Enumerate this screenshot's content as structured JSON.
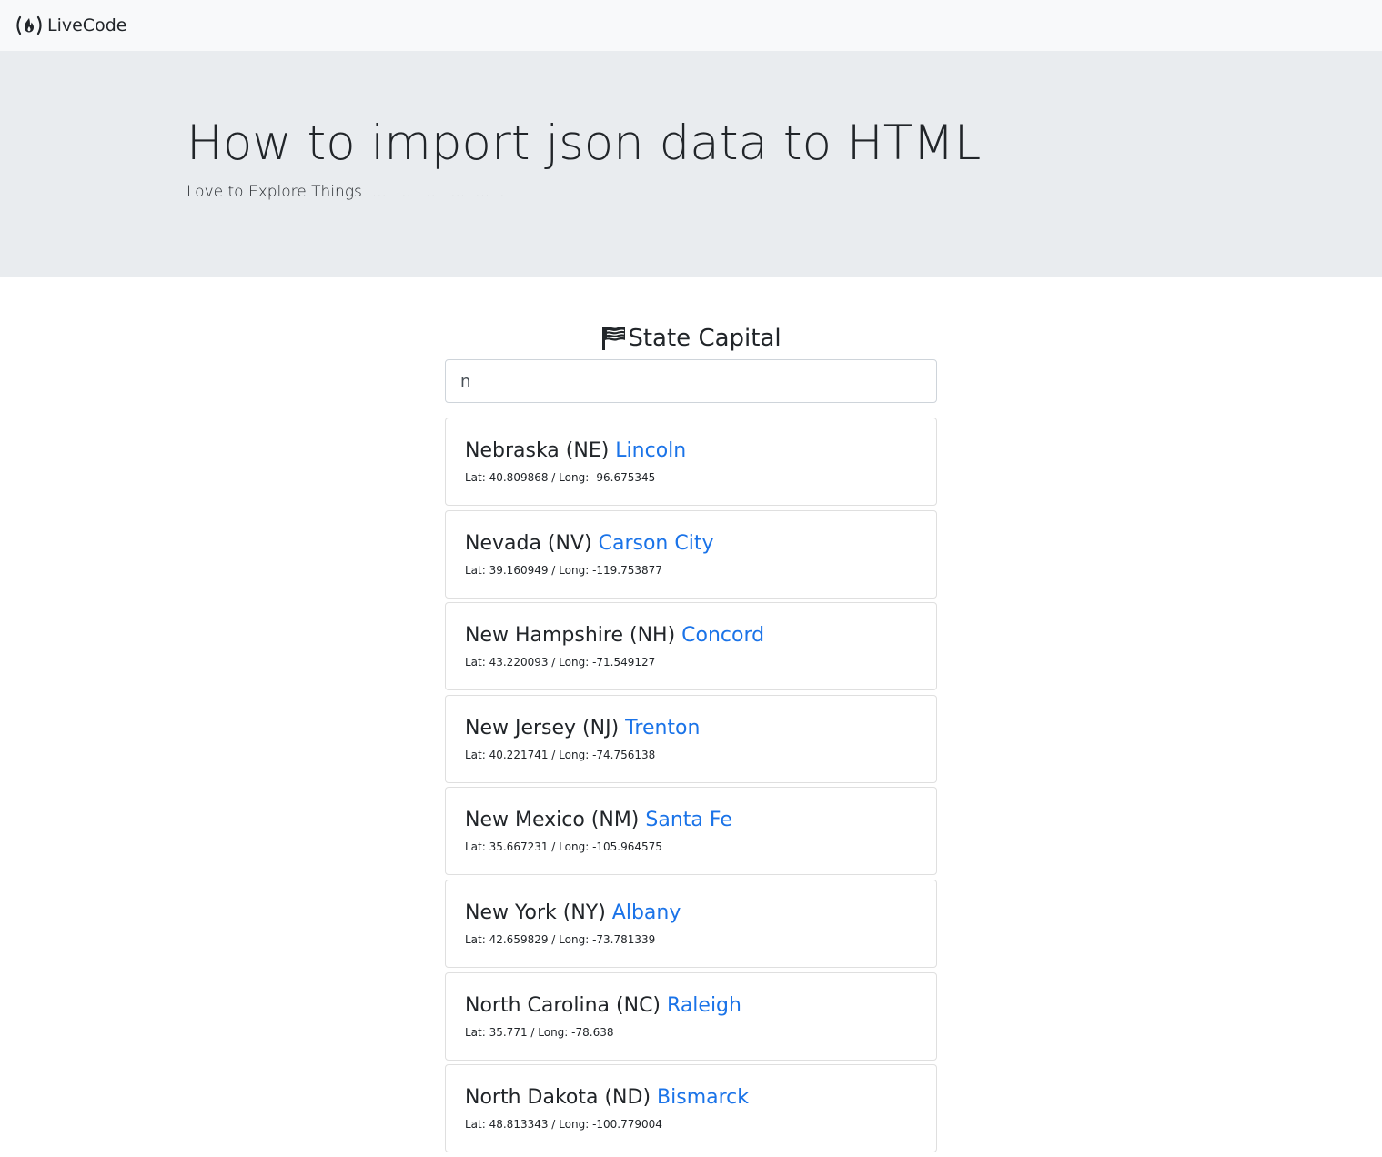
{
  "navbar": {
    "brand_label": "LiveCode",
    "brand_icon": "freecodecamp-flame-icon"
  },
  "jumbotron": {
    "title": "How to import json data to HTML",
    "lead": "Love to Explore Things............................."
  },
  "section": {
    "title": "State Capital",
    "title_icon": "flag-icon"
  },
  "search": {
    "value": "n",
    "placeholder": ""
  },
  "results": [
    {
      "state": "Nebraska (NE)",
      "capital": "Lincoln",
      "coords": "Lat: 40.809868 / Long: -96.675345"
    },
    {
      "state": "Nevada (NV)",
      "capital": "Carson City",
      "coords": "Lat: 39.160949 / Long: -119.753877"
    },
    {
      "state": "New Hampshire (NH)",
      "capital": "Concord",
      "coords": "Lat: 43.220093 / Long: -71.549127"
    },
    {
      "state": "New Jersey (NJ)",
      "capital": "Trenton",
      "coords": "Lat: 40.221741 / Long: -74.756138"
    },
    {
      "state": "New Mexico (NM)",
      "capital": "Santa Fe",
      "coords": "Lat: 35.667231 / Long: -105.964575"
    },
    {
      "state": "New York (NY)",
      "capital": "Albany",
      "coords": "Lat: 42.659829 / Long: -73.781339"
    },
    {
      "state": "North Carolina (NC)",
      "capital": "Raleigh",
      "coords": "Lat: 35.771 / Long: -78.638"
    },
    {
      "state": "North Dakota (ND)",
      "capital": "Bismarck",
      "coords": "Lat: 48.813343 / Long: -100.779004"
    }
  ],
  "colors": {
    "link_blue": "#1a73e8",
    "navbar_bg": "#f8f9fa",
    "jumbotron_bg": "#e9ecef"
  }
}
